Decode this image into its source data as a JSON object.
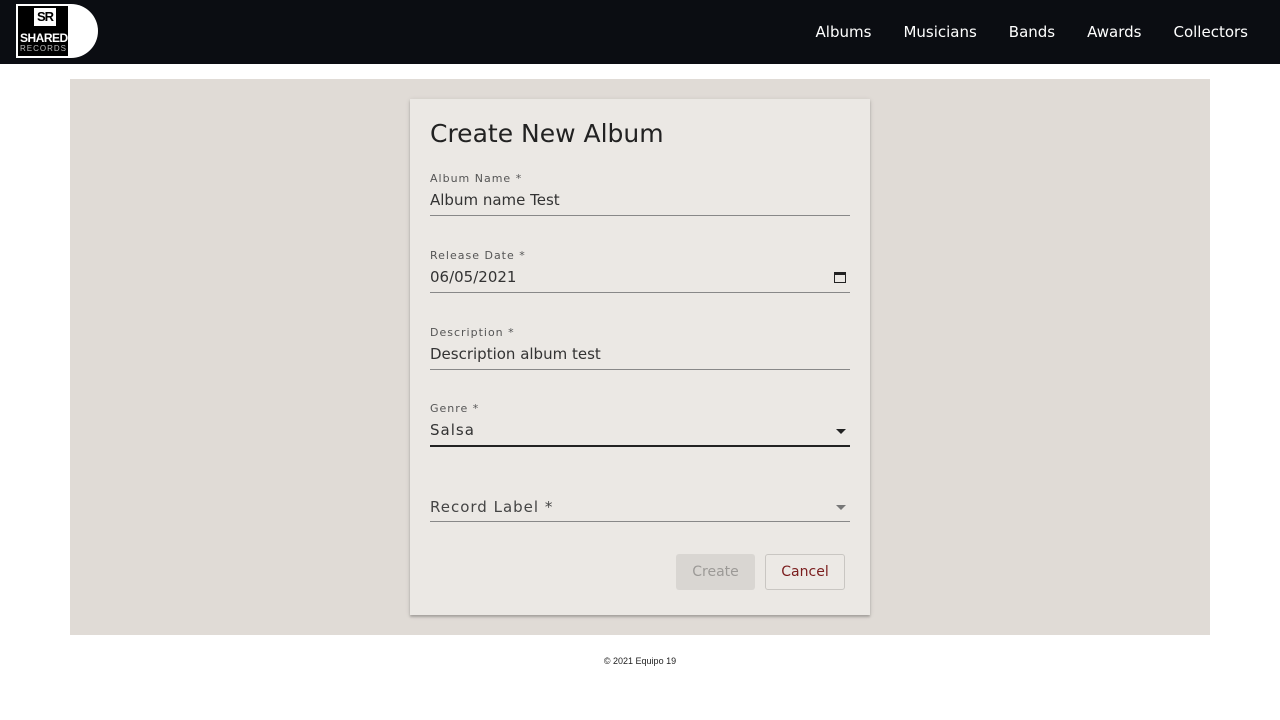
{
  "header": {
    "logo": {
      "top_text": "SR",
      "main_text": "SHARED",
      "sub_text": "RECORDS"
    },
    "nav": [
      "Albums",
      "Musicians",
      "Bands",
      "Awards",
      "Collectors"
    ]
  },
  "form": {
    "title": "Create New Album",
    "album_name": {
      "label": "Album Name *",
      "value": "Album name Test"
    },
    "release_date": {
      "label": "Release Date *",
      "value": "06/05/2021"
    },
    "description": {
      "label": "Description *",
      "value": "Description album test"
    },
    "genre": {
      "label": "Genre *",
      "value": "Salsa"
    },
    "record_label": {
      "placeholder": "Record Label *"
    },
    "create_label": "Create",
    "cancel_label": "Cancel"
  },
  "footer": {
    "text": "© 2021 Equipo 19"
  },
  "colors": {
    "navbar": "#0b0d12",
    "panel": "#e0dbd6",
    "card": "#ebe8e4",
    "cancel_text": "#7a1c1c"
  }
}
